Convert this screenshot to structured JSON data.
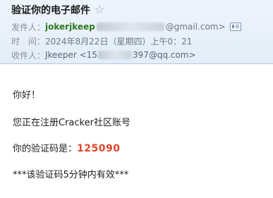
{
  "email": {
    "subject": "验证你的电子邮件",
    "star_icon": "star-outline-icon",
    "from_label": "发件人：",
    "sender_name": "jokerjkeep",
    "sender_email_suffix": "@gmail.com>",
    "time_label": "时　间：",
    "time_value": "2024年8月22日（星期四）上午0：21",
    "to_label": "收件人：",
    "recipient_name": "Jkeeper <",
    "recipient_prefix": "15",
    "recipient_suffix": "397@qq.com>",
    "contact_card_icon": "contact-card-icon"
  },
  "body": {
    "greeting": "你好！",
    "intro": "您正在注册Cracker社区账号",
    "code_label": "你的验证码是：",
    "code_value": "125090",
    "validity": "***该验证码5分钟内有效***"
  },
  "colors": {
    "header_bg": "#e3edf8",
    "sender_green": "#2d7a1f",
    "code_red": "#e0442a"
  }
}
